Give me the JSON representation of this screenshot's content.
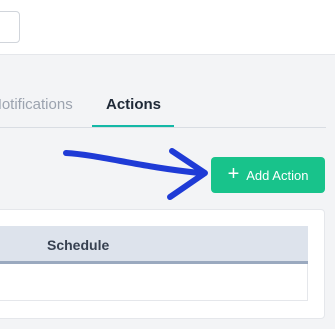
{
  "tabs": [
    {
      "label": "Notifications"
    },
    {
      "label": "Actions"
    }
  ],
  "toolbar": {
    "add_action_label": "Add Action",
    "add_action_icon": "plus-icon"
  },
  "table": {
    "columns": [
      "Schedule"
    ]
  },
  "colors": {
    "accent": "#18c38b",
    "tab_active_underline": "#14b8a6",
    "annotation_arrow": "#1f3bd6"
  }
}
